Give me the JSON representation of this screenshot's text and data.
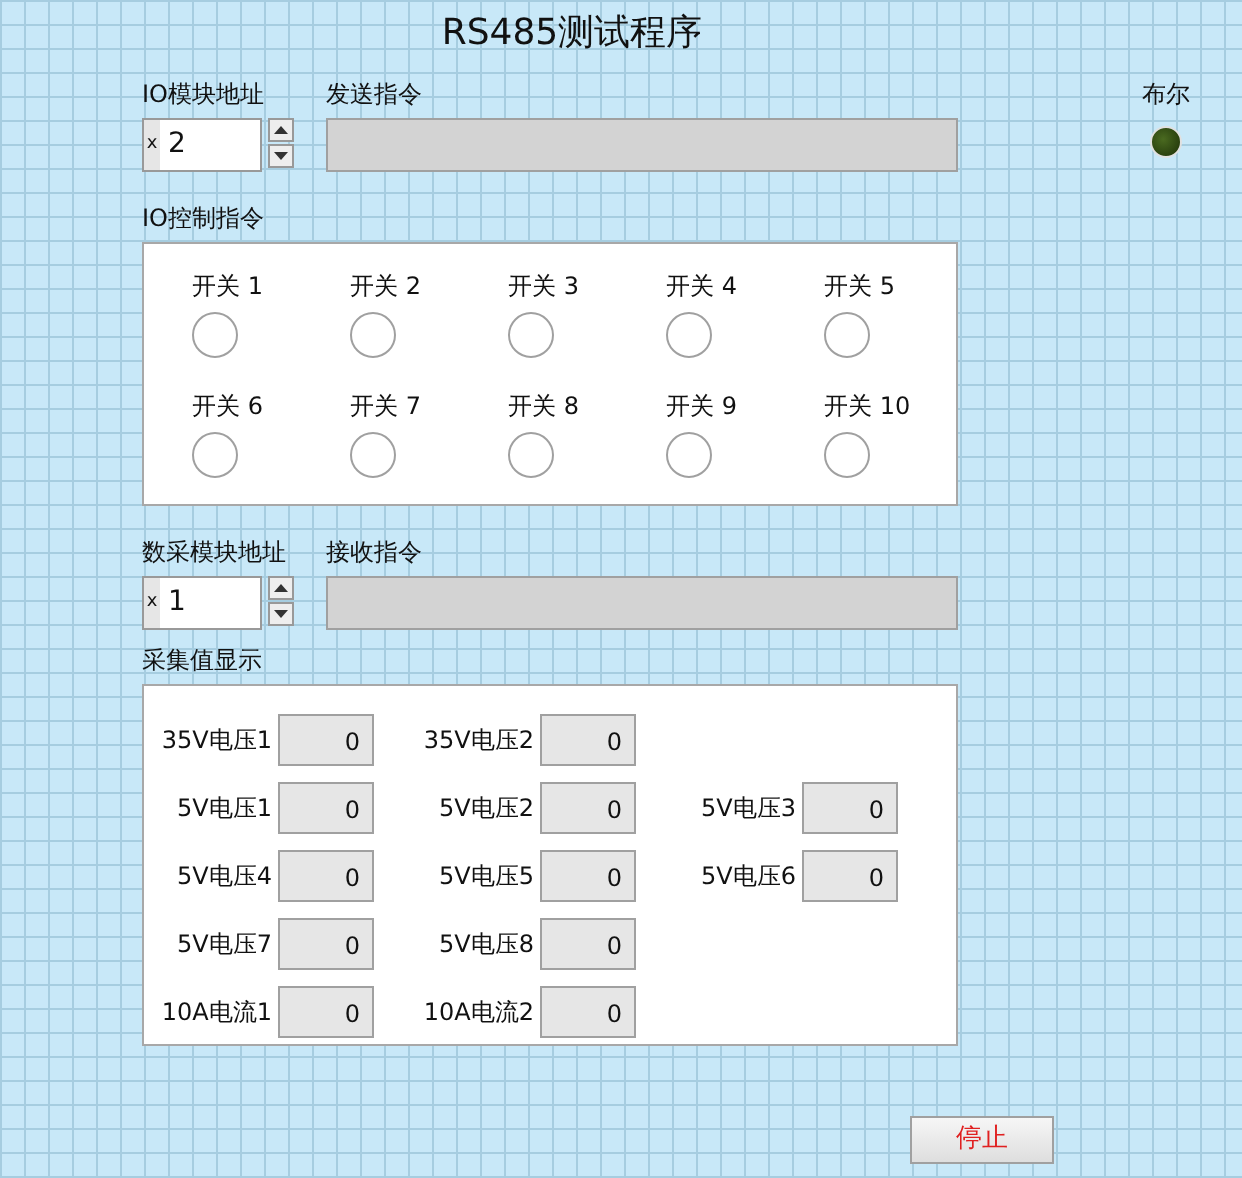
{
  "title": "RS485测试程序",
  "io_address": {
    "label": "IO模块地址",
    "radix": "x",
    "value": "2"
  },
  "send_command": {
    "label": "发送指令"
  },
  "led": {
    "label": "布尔",
    "on": false
  },
  "io_control": {
    "label": "IO控制指令",
    "switches": [
      {
        "label": "开关 1",
        "on": false
      },
      {
        "label": "开关 2",
        "on": false
      },
      {
        "label": "开关 3",
        "on": false
      },
      {
        "label": "开关 4",
        "on": false
      },
      {
        "label": "开关 5",
        "on": false
      },
      {
        "label": "开关 6",
        "on": false
      },
      {
        "label": "开关 7",
        "on": false
      },
      {
        "label": "开关 8",
        "on": false
      },
      {
        "label": "开关 9",
        "on": false
      },
      {
        "label": "开关 10",
        "on": false
      }
    ]
  },
  "daq_address": {
    "label": "数采模块地址",
    "radix": "x",
    "value": "1"
  },
  "receive_command": {
    "label": "接收指令"
  },
  "acquisition": {
    "label": "采集值显示",
    "rows": [
      [
        {
          "label": "35V电压1",
          "value": "0"
        },
        {
          "label": "35V电压2",
          "value": "0"
        }
      ],
      [
        {
          "label": "5V电压1",
          "value": "0"
        },
        {
          "label": "5V电压2",
          "value": "0"
        },
        {
          "label": "5V电压3",
          "value": "0"
        }
      ],
      [
        {
          "label": "5V电压4",
          "value": "0"
        },
        {
          "label": "5V电压5",
          "value": "0"
        },
        {
          "label": "5V电压6",
          "value": "0"
        }
      ],
      [
        {
          "label": "5V电压7",
          "value": "0"
        },
        {
          "label": "5V电压8",
          "value": "0"
        }
      ],
      [
        {
          "label": "10A电流1",
          "value": "0"
        },
        {
          "label": "10A电流2",
          "value": "0"
        }
      ]
    ]
  },
  "stop_button": {
    "label": "停止"
  }
}
